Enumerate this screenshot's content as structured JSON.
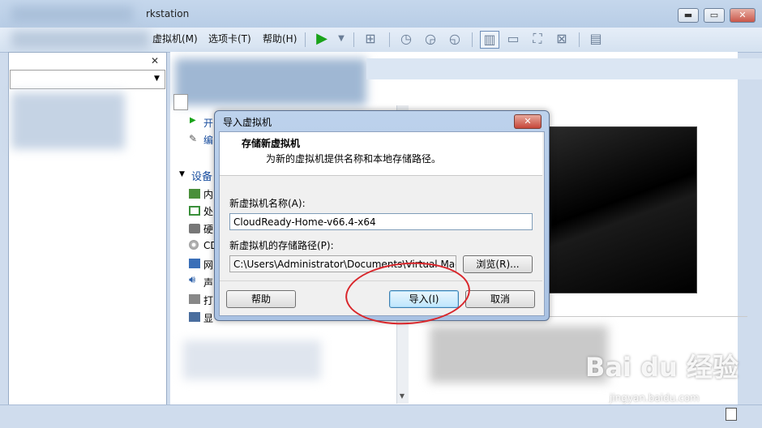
{
  "app": {
    "title_fragment": "rkstation",
    "window_controls": {
      "minimize": "▬",
      "maximize": "▭",
      "close": "✕"
    }
  },
  "menu": {
    "vm": "虚拟机(M)",
    "tabs": "选项卡(T)",
    "help": "帮助(H)"
  },
  "sidebar": {
    "close_glyph": "✕",
    "items": [
      {
        "label": "开"
      },
      {
        "label": "编"
      }
    ],
    "devices_header": "设备",
    "devices": [
      {
        "icon": "memory-icon",
        "label": "内"
      },
      {
        "icon": "cpu-icon",
        "label": "处"
      },
      {
        "icon": "harddisk-icon",
        "label": "硬"
      },
      {
        "icon": "cd-icon",
        "label": "CD"
      },
      {
        "icon": "network-icon",
        "label": "网"
      },
      {
        "icon": "sound-icon",
        "label": "声"
      },
      {
        "icon": "printer-icon",
        "label": "打"
      },
      {
        "icon": "display-icon",
        "label": "显"
      }
    ]
  },
  "dialog": {
    "title": "导入虚拟机",
    "close_glyph": "✕",
    "header_title": "存储新虚拟机",
    "header_subtitle": "为新的虚拟机提供名称和本地存储路径。",
    "name_label": "新虚拟机名称(A):",
    "name_value": "CloudReady-Home-v66.4-x64",
    "path_label": "新虚拟机的存储路径(P):",
    "path_value": "C:\\Users\\Administrator\\Documents\\Virtual Machine",
    "browse_label": "浏览(R)...",
    "help_label": "帮助",
    "import_label": "导入(I)",
    "cancel_label": "取消"
  },
  "watermark": {
    "logo": "Bai du 经验",
    "url": "jingyan.baidu.com"
  }
}
